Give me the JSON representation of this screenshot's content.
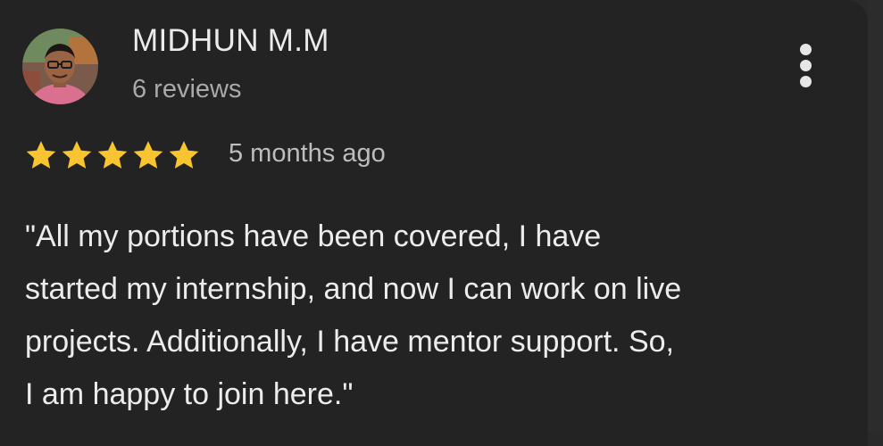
{
  "review": {
    "reviewer_name": "MIDHUN M.M",
    "review_count": "6 reviews",
    "rating": 5,
    "rating_max": 5,
    "time_ago": "5 months ago",
    "text_lines": [
      "\"All my portions have been covered, I have",
      "started my internship, and now I can work on live",
      "projects. Additionally, I have mentor support. So,",
      "I am happy to join here.\""
    ]
  },
  "colors": {
    "background": "#232323",
    "star": "#f8c531",
    "name_text": "#ebebeb",
    "muted_text": "#a9a9a9"
  },
  "icons": {
    "menu": "more-vert-icon",
    "star": "star-icon",
    "avatar": "avatar"
  }
}
